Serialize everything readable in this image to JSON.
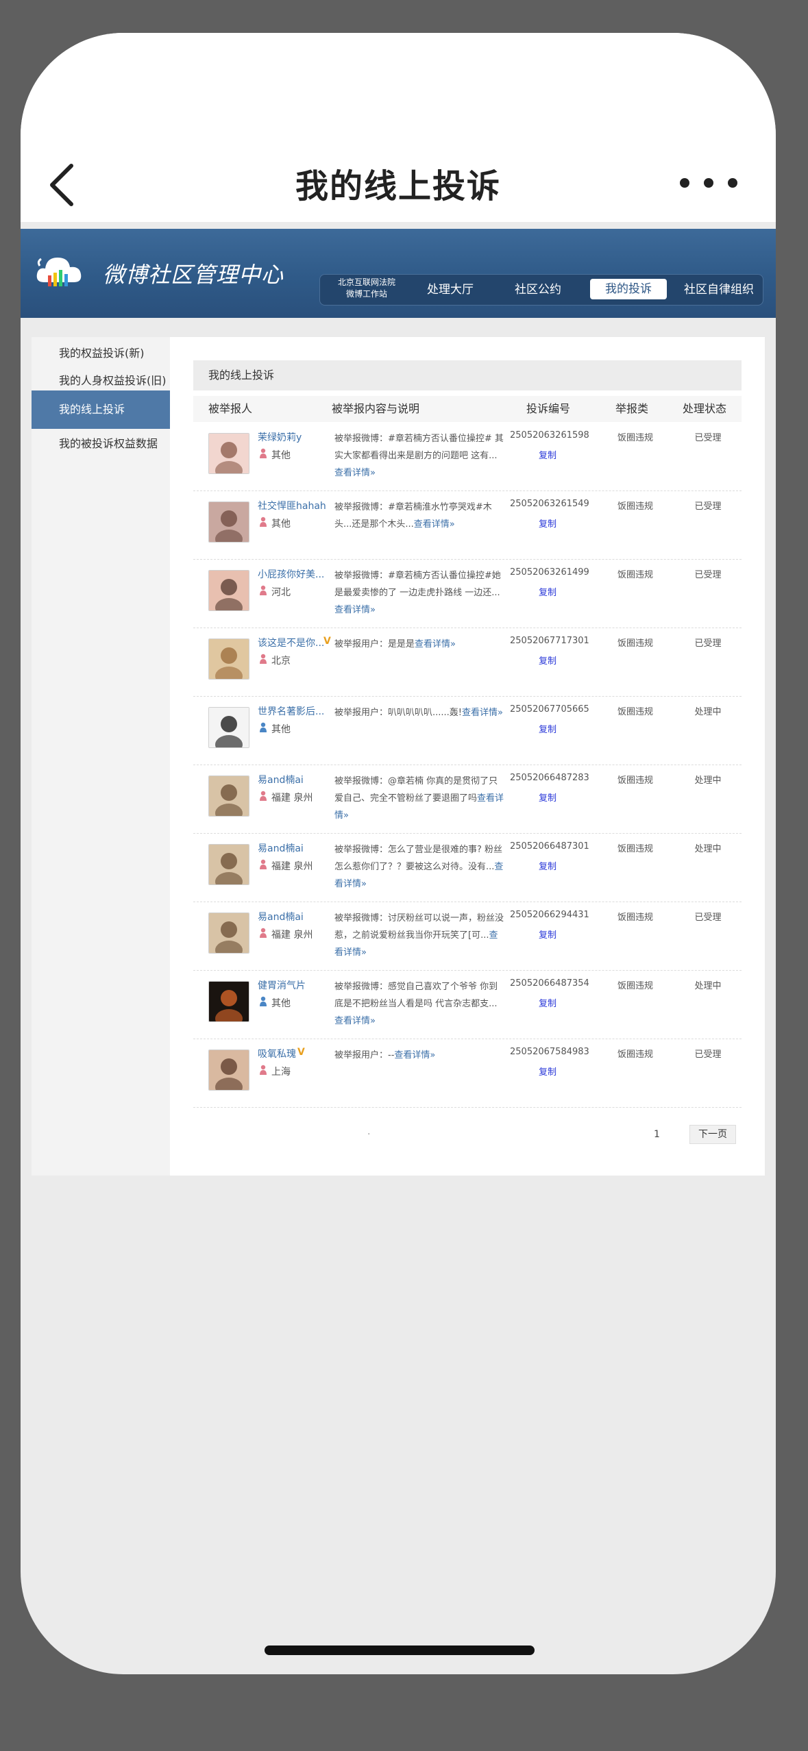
{
  "nav": {
    "title": "我的线上投诉"
  },
  "banner": {
    "title": "微博社区管理中心",
    "court_line1": "北京互联网法院",
    "court_line2": "微博工作站",
    "items": [
      "处理大厅",
      "社区公约",
      "我的投诉",
      "社区自律组织"
    ],
    "active": "我的投诉"
  },
  "sidebar": {
    "items": [
      "我的权益投诉(新)",
      "我的人身权益投诉(旧)",
      "我的线上投诉",
      "我的被投诉权益数据"
    ],
    "active": "我的线上投诉"
  },
  "main": {
    "heading": "我的线上投诉",
    "columns": [
      "被举报人",
      "被举报内容与说明",
      "投诉编号",
      "举报类",
      "处理状态"
    ],
    "copy_label": "复制",
    "rows": [
      {
        "name": "茉绿奶莉y",
        "gender": "female",
        "location": "其他",
        "desc": "被举报微博：#章若楠方否认番位操控# 其实大家都看得出来是剧方的问题吧 这有...",
        "link": "查看详情»",
        "id": "25052063261598",
        "type": "饭圈违规",
        "status": "已受理",
        "verified": false
      },
      {
        "name": "社交悍匪hahah",
        "gender": "female",
        "location": "其他",
        "desc": "被举报微博：#章若楠淮水竹亭哭戏#木头...还是那个木头...",
        "link": "查看详情»",
        "id": "25052063261549",
        "type": "饭圈违规",
        "status": "已受理",
        "verified": false
      },
      {
        "name": "小屁孩你好美...",
        "gender": "female",
        "location": "河北",
        "desc": "被举报微博：#章若楠方否认番位操控#她是最爱卖惨的了 一边走虎扑路线 一边还...",
        "link": "查看详情»",
        "id": "25052063261499",
        "type": "饭圈违规",
        "status": "已受理",
        "verified": false
      },
      {
        "name": "该这是不是你...",
        "gender": "female",
        "location": "北京",
        "desc": "被举报用户：是是是",
        "link": "查看详情»",
        "id": "25052067717301",
        "type": "饭圈违规",
        "status": "已受理",
        "verified": true
      },
      {
        "name": "世界名著影后...",
        "gender": "male",
        "location": "其他",
        "desc": "被举报用户：叭叭叭叭叭......轰!",
        "link": "查看详情»",
        "id": "25052067705665",
        "type": "饭圈违规",
        "status": "处理中",
        "verified": false
      },
      {
        "name": "易and楠ai",
        "gender": "female",
        "location": "福建 泉州",
        "desc": "被举报微博：@章若楠 你真的是贯彻了只爱自己、完全不管粉丝了要退圈了吗",
        "link": "查看详情»",
        "id": "25052066487283",
        "type": "饭圈违规",
        "status": "处理中",
        "verified": false
      },
      {
        "name": "易and楠ai",
        "gender": "female",
        "location": "福建 泉州",
        "desc": "被举报微博：怎么了营业是很难的事? 粉丝怎么惹你们了？？要被这么对待。没有...",
        "link": "查看详情»",
        "id": "25052066487301",
        "type": "饭圈违规",
        "status": "处理中",
        "verified": false
      },
      {
        "name": "易and楠ai",
        "gender": "female",
        "location": "福建 泉州",
        "desc": "被举报微博：讨厌粉丝可以说一声，粉丝没惹，之前说爱粉丝我当你开玩笑了[可...",
        "link": "查看详情»",
        "id": "25052066294431",
        "type": "饭圈违规",
        "status": "已受理",
        "verified": false
      },
      {
        "name": "健胃消气片",
        "gender": "male",
        "location": "其他",
        "desc": "被举报微博：感觉自己喜欢了个爷爷 你到底是不把粉丝当人看是吗 代言杂志都支...",
        "link": "查看详情»",
        "id": "25052066487354",
        "type": "饭圈违规",
        "status": "处理中",
        "verified": false
      },
      {
        "name": "吸氧私瑰",
        "gender": "female",
        "location": "上海",
        "desc": "被举报用户：--",
        "link": "查看详情»",
        "id": "25052067584983",
        "type": "饭圈违规",
        "status": "已受理",
        "verified": true
      }
    ]
  },
  "pager": {
    "page": "1",
    "next_label": "下一页",
    "dot": "."
  },
  "colors": {
    "banner": "#2f5a88",
    "sidebar_active": "#4f79a7",
    "link": "#3b6fa8",
    "copy": "#2a38d8"
  }
}
